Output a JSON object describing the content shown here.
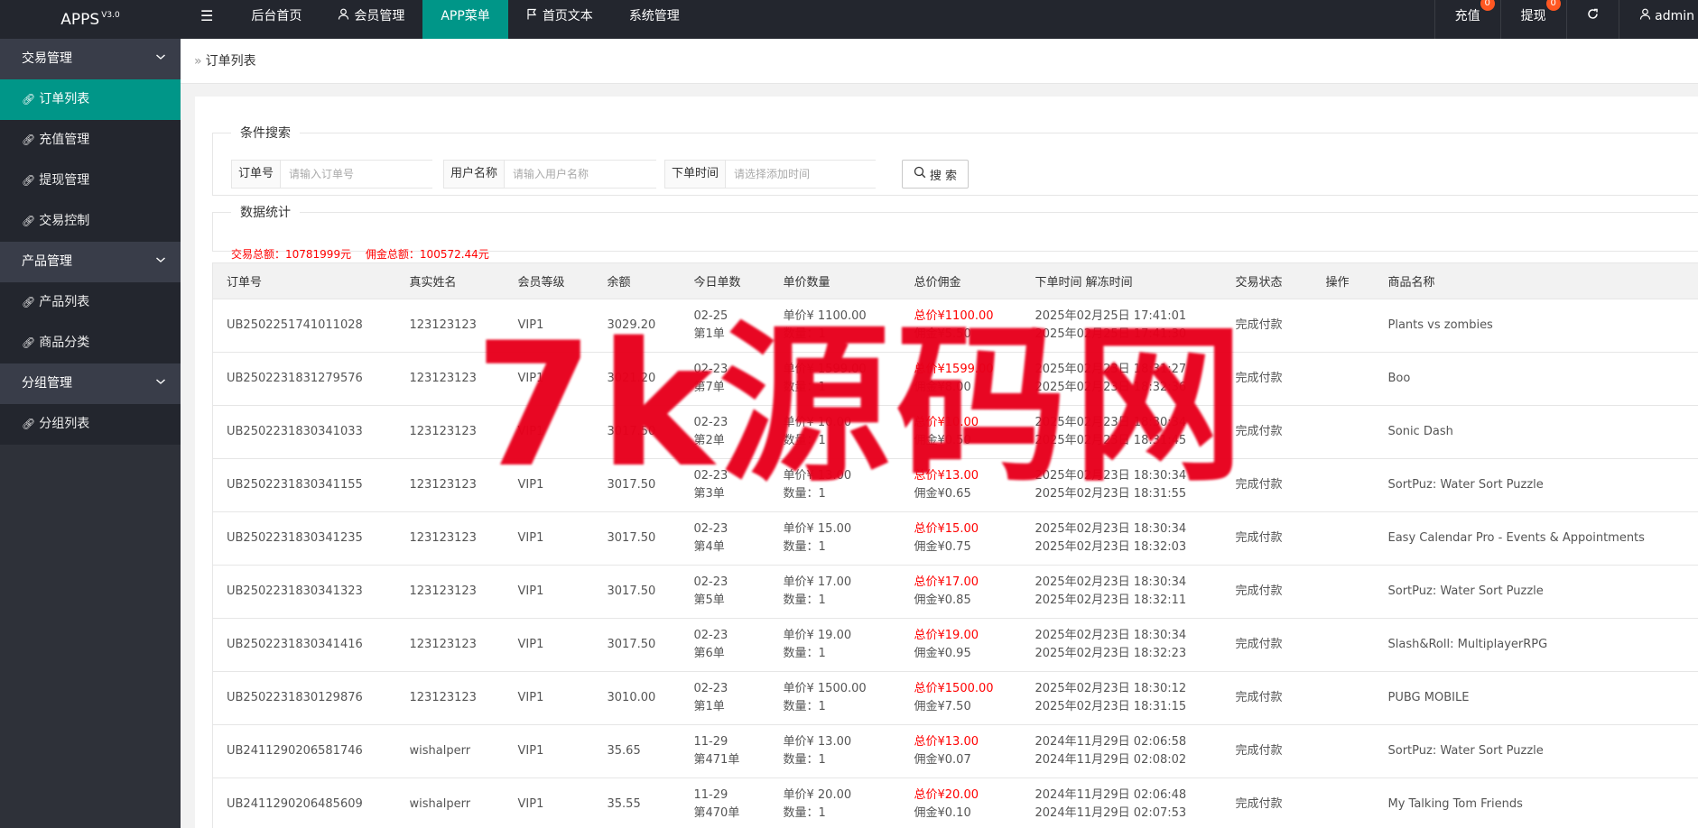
{
  "header": {
    "logo": "APPS",
    "version": "V3.0",
    "nav": [
      {
        "label": "后台首页",
        "icon": ""
      },
      {
        "label": "会员管理",
        "icon": "user-icon"
      },
      {
        "label": "APP菜单",
        "icon": "",
        "active": true
      },
      {
        "label": "首页文本",
        "icon": "flag-icon"
      },
      {
        "label": "系统管理",
        "icon": ""
      }
    ],
    "recharge": {
      "label": "充值",
      "badge": "0"
    },
    "withdraw": {
      "label": "提现",
      "badge": "0"
    },
    "user": "admin"
  },
  "sidebar": {
    "groups": [
      {
        "title": "交易管理",
        "items": [
          "订单列表",
          "充值管理",
          "提现管理",
          "交易控制"
        ]
      },
      {
        "title": "产品管理",
        "items": [
          "产品列表",
          "商品分类"
        ]
      },
      {
        "title": "分组管理",
        "items": [
          "分组列表"
        ]
      }
    ]
  },
  "breadcrumb": "订单列表",
  "search": {
    "legend": "条件搜索",
    "order_label": "订单号",
    "order_placeholder": "请输入订单号",
    "user_label": "用户名称",
    "user_placeholder": "请输入用户名称",
    "time_label": "下单时间",
    "time_placeholder": "请选择添加时间",
    "button": "搜 索"
  },
  "stats": {
    "legend": "数据统计",
    "trade_total": "交易总额：10781999元",
    "commission_total": "佣金总额：100572.44元"
  },
  "table": {
    "headers": [
      "订单号",
      "真实姓名",
      "会员等级",
      "余额",
      "今日单数",
      "单价数量",
      "总价佣金",
      "下单时间 解冻时间",
      "交易状态",
      "操作",
      "商品名称"
    ],
    "rows": [
      {
        "order": "UB2502251741011028",
        "name": "123123123",
        "level": "VIP1",
        "balance": "3029.20",
        "day": "02-25",
        "count": "第1单",
        "price": "单价¥  1100.00",
        "qty": "数量：1",
        "total": "总价¥1100.00",
        "comm": "佣金¥5.50",
        "t1": "2025年02月25日 17:41:01",
        "t2": "2025年02月25日 17:41:30",
        "status": "完成付款",
        "product": "Plants vs zombies"
      },
      {
        "order": "UB2502231831279576",
        "name": "123123123",
        "level": "VIP1",
        "balance": "3021.20",
        "day": "02-23",
        "count": "第7单",
        "price": "单价¥  1599.00",
        "qty": "数量：1",
        "total": "总价¥1599.00",
        "comm": "佣金¥8.00",
        "t1": "2025年02月23日 18:31:27",
        "t2": "2025年02月23日 18:32:36",
        "status": "完成付款",
        "product": "Boo"
      },
      {
        "order": "UB2502231830341033",
        "name": "123123123",
        "level": "VIP1",
        "balance": "3017.50",
        "day": "02-23",
        "count": "第2单",
        "price": "单价¥  10.00",
        "qty": "数量：1",
        "total": "总价¥10.00",
        "comm": "佣金¥0.50",
        "t1": "2025年02月23日 18:30:34",
        "t2": "2025年02月23日 18:31:45",
        "status": "完成付款",
        "product": "Sonic Dash"
      },
      {
        "order": "UB2502231830341155",
        "name": "123123123",
        "level": "VIP1",
        "balance": "3017.50",
        "day": "02-23",
        "count": "第3单",
        "price": "单价¥  13.00",
        "qty": "数量：1",
        "total": "总价¥13.00",
        "comm": "佣金¥0.65",
        "t1": "2025年02月23日 18:30:34",
        "t2": "2025年02月23日 18:31:55",
        "status": "完成付款",
        "product": "SortPuz: Water Sort Puzzle"
      },
      {
        "order": "UB2502231830341235",
        "name": "123123123",
        "level": "VIP1",
        "balance": "3017.50",
        "day": "02-23",
        "count": "第4单",
        "price": "单价¥  15.00",
        "qty": "数量：1",
        "total": "总价¥15.00",
        "comm": "佣金¥0.75",
        "t1": "2025年02月23日 18:30:34",
        "t2": "2025年02月23日 18:32:03",
        "status": "完成付款",
        "product": "Easy Calendar Pro - Events & Appointments"
      },
      {
        "order": "UB2502231830341323",
        "name": "123123123",
        "level": "VIP1",
        "balance": "3017.50",
        "day": "02-23",
        "count": "第5单",
        "price": "单价¥  17.00",
        "qty": "数量：1",
        "total": "总价¥17.00",
        "comm": "佣金¥0.85",
        "t1": "2025年02月23日 18:30:34",
        "t2": "2025年02月23日 18:32:11",
        "status": "完成付款",
        "product": "SortPuz: Water Sort Puzzle"
      },
      {
        "order": "UB2502231830341416",
        "name": "123123123",
        "level": "VIP1",
        "balance": "3017.50",
        "day": "02-23",
        "count": "第6单",
        "price": "单价¥  19.00",
        "qty": "数量：1",
        "total": "总价¥19.00",
        "comm": "佣金¥0.95",
        "t1": "2025年02月23日 18:30:34",
        "t2": "2025年02月23日 18:32:23",
        "status": "完成付款",
        "product": "Slash&Roll: MultiplayerRPG"
      },
      {
        "order": "UB2502231830129876",
        "name": "123123123",
        "level": "VIP1",
        "balance": "3010.00",
        "day": "02-23",
        "count": "第1单",
        "price": "单价¥  1500.00",
        "qty": "数量：1",
        "total": "总价¥1500.00",
        "comm": "佣金¥7.50",
        "t1": "2025年02月23日 18:30:12",
        "t2": "2025年02月23日 18:31:15",
        "status": "完成付款",
        "product": "PUBG MOBILE"
      },
      {
        "order": "UB2411290206581746",
        "name": "wishalperr",
        "level": "VIP1",
        "balance": "35.65",
        "day": "11-29",
        "count": "第471单",
        "price": "单价¥  13.00",
        "qty": "数量：1",
        "total": "总价¥13.00",
        "comm": "佣金¥0.07",
        "t1": "2024年11月29日 02:06:58",
        "t2": "2024年11月29日 02:08:02",
        "status": "完成付款",
        "product": "SortPuz: Water Sort Puzzle"
      },
      {
        "order": "UB2411290206485609",
        "name": "wishalperr",
        "level": "VIP1",
        "balance": "35.55",
        "day": "11-29",
        "count": "第470单",
        "price": "单价¥  20.00",
        "qty": "数量：1",
        "total": "总价¥20.00",
        "comm": "佣金¥0.10",
        "t1": "2024年11月29日 02:06:48",
        "t2": "2024年11月29日 02:07:53",
        "status": "完成付款",
        "product": "My Talking Tom Friends"
      }
    ]
  },
  "watermark": "7k源码网",
  "colors": {
    "accent": "#009688",
    "dark": "#23262e",
    "red": "#ff0000",
    "watermark": "#e8001c"
  }
}
